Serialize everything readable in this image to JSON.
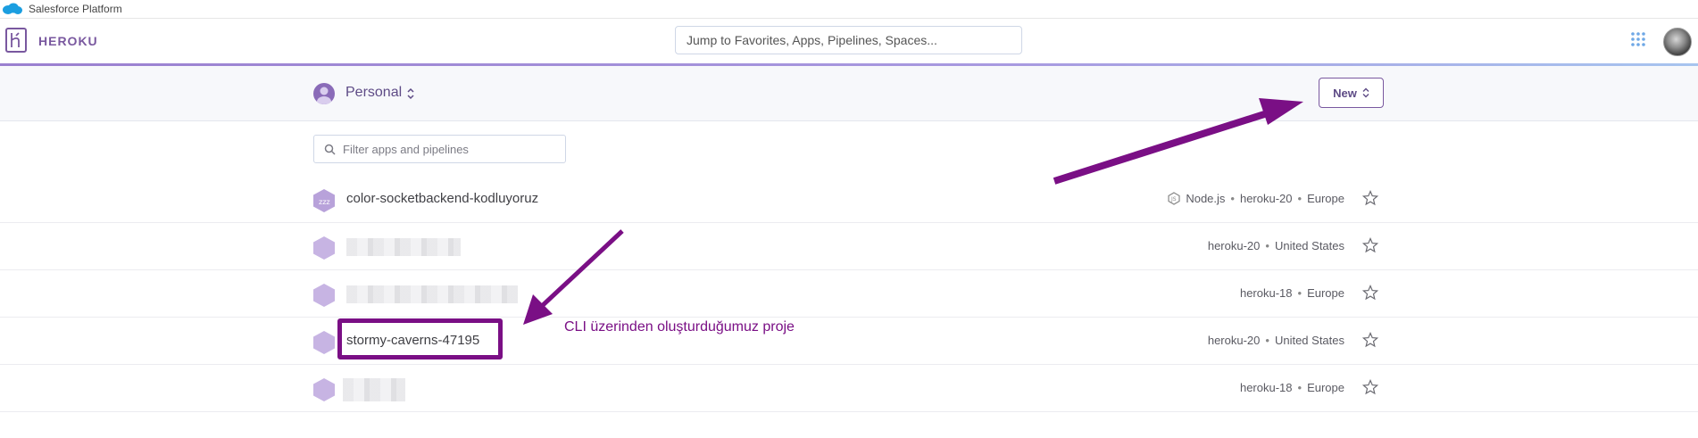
{
  "salesforce_bar": {
    "label": "Salesforce Platform"
  },
  "header": {
    "brand": "HEROKU",
    "search_placeholder": "Jump to Favorites, Apps, Pipelines, Spaces..."
  },
  "subheader": {
    "account": "Personal",
    "new_button": "New"
  },
  "filter": {
    "placeholder": "Filter apps and pipelines"
  },
  "apps": [
    {
      "name": "color-socketbackend-kodluyoruz",
      "language": "Node.js",
      "stack": "heroku-20",
      "region": "Europe",
      "sleeping": true
    },
    {
      "name": "",
      "stack": "heroku-20",
      "region": "United States",
      "blurred": true
    },
    {
      "name": "",
      "stack": "heroku-18",
      "region": "Europe",
      "blurred": true
    },
    {
      "name": "stormy-caverns-47195",
      "stack": "heroku-20",
      "region": "United States",
      "highlighted": true
    },
    {
      "name": "",
      "stack": "heroku-18",
      "region": "Europe",
      "blurred": true
    }
  ],
  "annotation": {
    "text": "CLI üzerinden oluşturduğumuz proje"
  },
  "colors": {
    "heroku_purple": "#79589f",
    "annotation_purple": "#7a0f85",
    "hex_light": "#c7b4e3"
  }
}
